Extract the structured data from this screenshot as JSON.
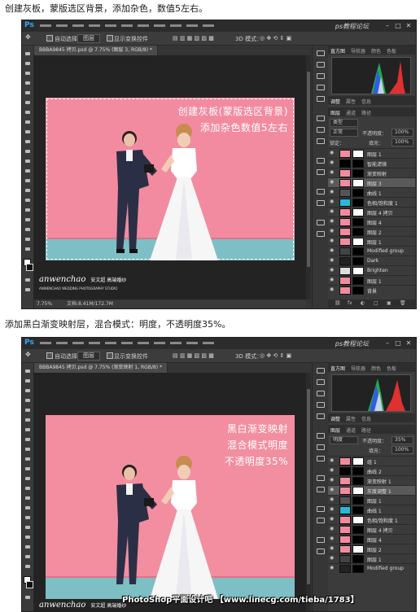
{
  "captions": {
    "step1": "创建灰板，蒙版选区背景，添加杂色，数值5左右。",
    "step2": "添加黑白渐变映射层，混合模式：明度，不透明度35%。"
  },
  "ps": {
    "logo": "Ps",
    "window_watermark": "ps教程论坛",
    "options": {
      "auto_select": "自动选择：",
      "auto_select_value": "图层",
      "show_transform": "显示变换控件",
      "mode_3d": "3D 模式："
    }
  },
  "screen1": {
    "doc_tab": "BBBA9845 拷贝.psd @ 7.75% (图层 3, RGB/8) *",
    "overlay_lines": [
      "创建灰板(蒙版选区背景)",
      "添加杂色数值5左右"
    ],
    "status_zoom": "7.75%",
    "status_doc": "文档:8.41M/172.7M",
    "logo": "anwenchao",
    "logo_cn": "安文超 高端婚纱",
    "logo_sub": "ANWENCHAO WEDDING PHOTOGRAPHY STUDIO",
    "panel_tabs": [
      "直方图",
      "导航器",
      "颜色",
      "色板"
    ],
    "adj_tabs": [
      "调整",
      "属性",
      "信息"
    ],
    "layer_tabs": [
      "图层",
      "通道",
      "路径"
    ],
    "kind_label": "类型",
    "blend_mode": "正常",
    "opacity_label": "不透明度：",
    "opacity_value": "100%",
    "lock_label": "锁定：",
    "fill_label": "填充：",
    "fill_value": "100%",
    "layers": [
      "图层 1",
      "智能滤镜",
      "渐变映射",
      "图层 3",
      "曲线 1",
      "色相/饱和度 1",
      "图层 4 拷贝",
      "图层 4",
      "图层 2",
      "图层 1",
      "Modified group",
      "Dark",
      "Brighten",
      "图层 1",
      "背景"
    ],
    "selected_layer": 3,
    "footer_icons": [
      "fx",
      "◐",
      "□",
      "▣",
      "🗑"
    ]
  },
  "screen2": {
    "doc_tab": "BBBA9845 拷贝.psd @ 7.75% (渐变映射 1, RGB/8) *",
    "overlay_lines": [
      "黑白渐变映射",
      "混合模式明度",
      "不透明度35%"
    ],
    "logo": "anwenchao",
    "logo_cn": "安文超 高端婚纱",
    "panel_tabs": [
      "直方图",
      "导航器",
      "颜色",
      "色板"
    ],
    "adj_tabs": [
      "调整",
      "属性",
      "信息"
    ],
    "layer_tabs": [
      "图层",
      "通道",
      "路径"
    ],
    "blend_mode": "明度",
    "opacity_label": "不透明度：",
    "opacity_value": "35%",
    "fill_label": "填充：",
    "fill_value": "100%",
    "layers": [
      "组 1",
      "曲线 2",
      "渐变映射 1",
      "灰度调整 1",
      "图层 1",
      "曲线 1",
      "色相/饱和度 1",
      "图层 4 拷贝",
      "图层 4",
      "图层 2",
      "图层 1",
      "Modified group"
    ],
    "selected_layer": 3
  },
  "footer_watermark": "PhotoShop平面设计吧 【www.linecg.com/tieba/1783】"
}
